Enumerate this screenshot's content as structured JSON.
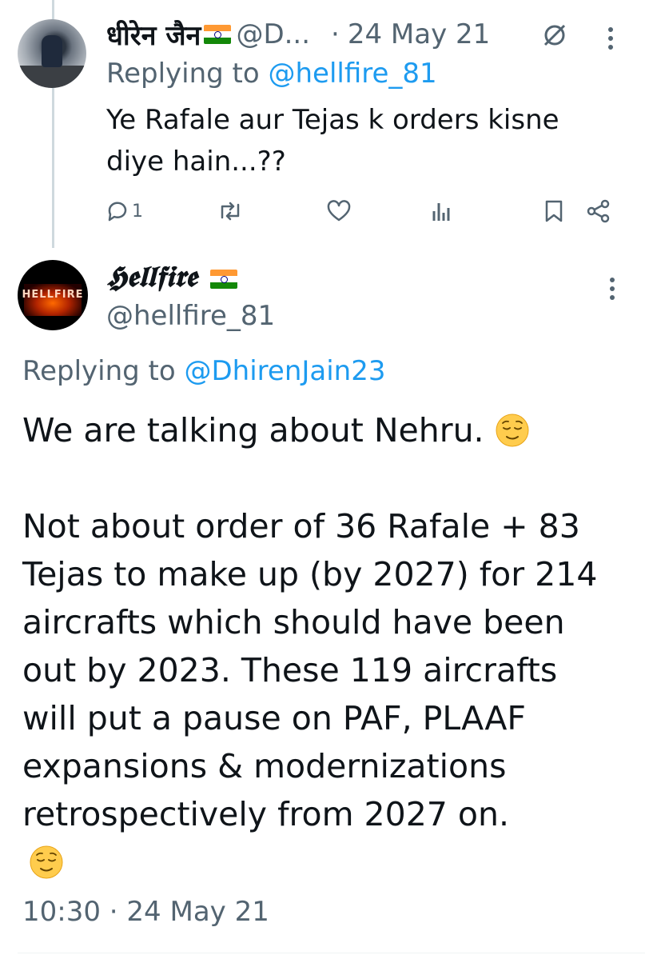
{
  "parent_tweet": {
    "author_name": "धीरेन जैन",
    "author_handle": "@D...",
    "separator": "·",
    "date": "24 May 21",
    "replying_label": "Replying to",
    "replying_to": "@hellfire_81",
    "text_line1": "Ye Rafale aur Tejas k orders kisne",
    "text_line2": "diye hain...??",
    "reply_count": "1",
    "icons": [
      "reply-icon",
      "retweet-icon",
      "like-icon",
      "views-icon",
      "bookmark-icon",
      "share-icon",
      "edit-icon",
      "more-icon",
      "india-flag-icon"
    ]
  },
  "main_tweet": {
    "author_name": "𝕳𝖊𝖑𝖑𝖋𝖎𝖗𝖊",
    "author_handle": "@hellfire_81",
    "avatar_text": "HELLFIRE",
    "replying_label": "Replying to",
    "replying_to": "@DhirenJain23",
    "paragraph1": "We are talking about Nehru.",
    "paragraph2_line1": "Not about order of 36 Rafale + 83",
    "paragraph2_line2": "Tejas to make up (by 2027) for 214",
    "paragraph2_line3": "aircrafts which should have been",
    "paragraph2_line4": "out by 2023. These 119 aircrafts",
    "paragraph2_line5": "will put a pause on PAF, PLAAF",
    "paragraph2_line6": "expansions & modernizations",
    "paragraph2_line7": "retrospectively from 2027 on.",
    "time": "10:30",
    "separator": "·",
    "date": "24 May 21",
    "icons": [
      "relieved-face-emoji",
      "more-icon",
      "india-flag-icon"
    ]
  },
  "colors": {
    "text": "#0f1419",
    "secondary": "#536471",
    "link": "#1d9bf0",
    "thread_line": "#cfd9de"
  }
}
